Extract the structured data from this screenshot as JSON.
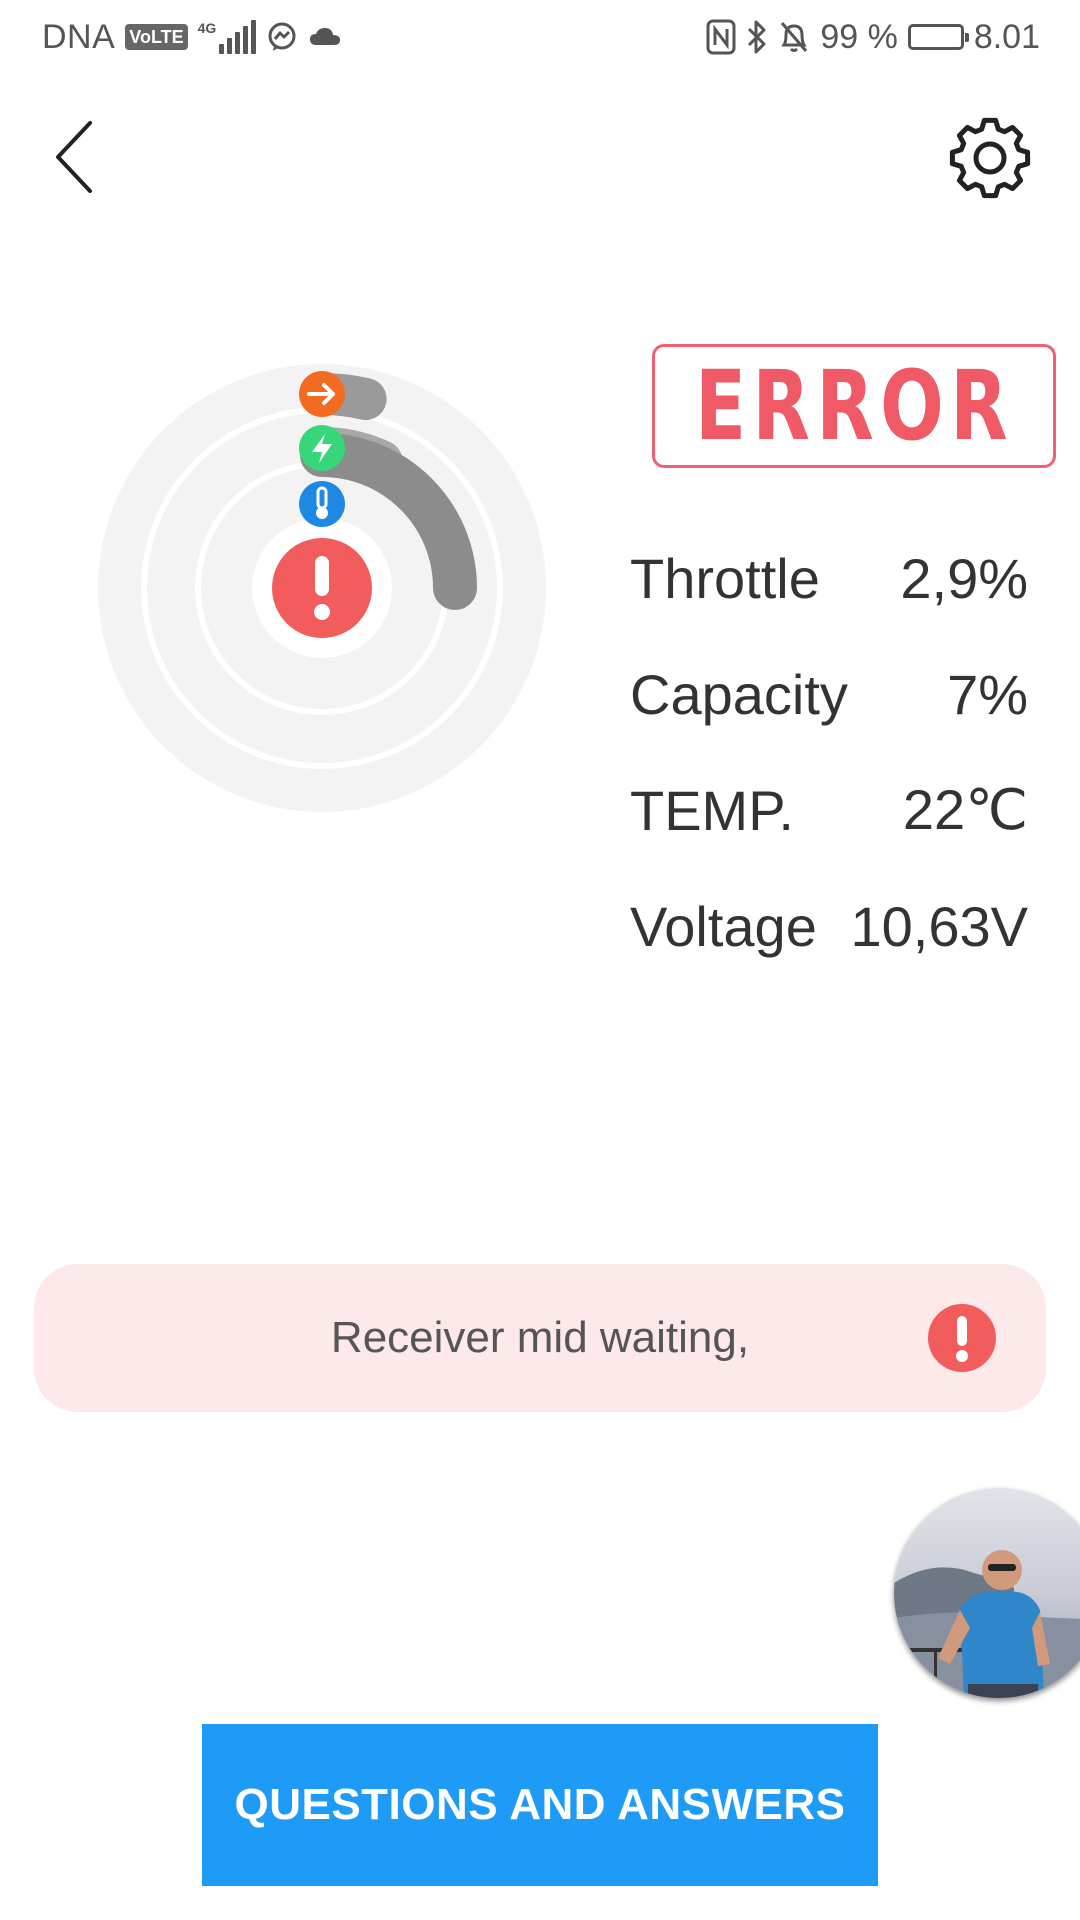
{
  "status_bar": {
    "carrier": "DNA",
    "volte": "VoLTE",
    "network": "4G",
    "battery_percent": "99 %",
    "time": "8.01"
  },
  "nav": {
    "back_icon": "chevron-left-icon",
    "settings_icon": "gear-icon"
  },
  "gauge": {
    "rings": [
      {
        "name": "throttle",
        "icon": "arrow-right-icon",
        "color": "#f26b21",
        "percent": 2.9
      },
      {
        "name": "capacity",
        "icon": "lightning-icon",
        "color": "#38d67a",
        "percent": 7
      },
      {
        "name": "temperature",
        "icon": "thermometer-icon",
        "color": "#1e88e5"
      }
    ],
    "center_icon": "exclamation-icon",
    "center_color": "#f25c5c"
  },
  "status": {
    "label": "ERROR",
    "color": "#f05a66"
  },
  "stats": [
    {
      "label": "Throttle",
      "value": "2,9%"
    },
    {
      "label": "Capacity",
      "value": "7%"
    },
    {
      "label": "TEMP.",
      "value": "22℃"
    },
    {
      "label": "Voltage",
      "value": "10,63V"
    }
  ],
  "alert": {
    "message": "Receiver mid waiting,",
    "icon": "exclamation-icon",
    "background": "#fde8ea"
  },
  "avatar": {
    "icon": "user-photo"
  },
  "cta": {
    "label": "QUESTIONS AND ANSWERS",
    "color": "#1e9bf6"
  }
}
